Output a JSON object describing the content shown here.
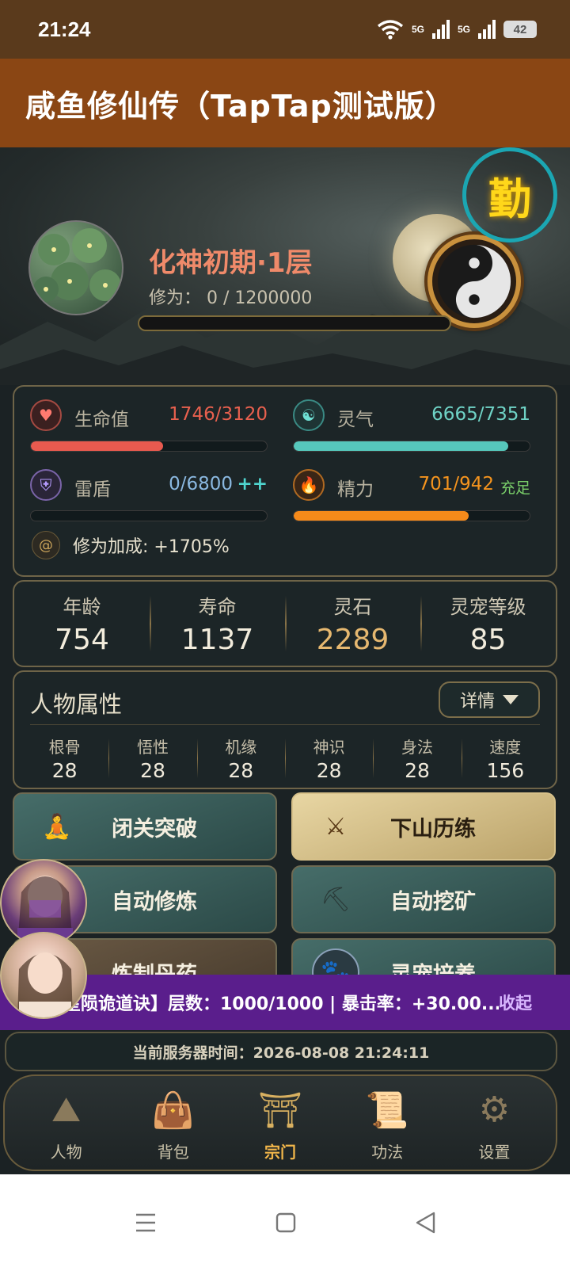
{
  "status_bar": {
    "time": "21:24",
    "network1": "5G",
    "network2": "5G",
    "battery": "42"
  },
  "app_bar": {
    "title": "咸鱼修仙传（TapTap测试版）"
  },
  "hero": {
    "badge": "勤",
    "realm": "化神初期·1层",
    "cultivation": "修为：  0 / 1200000",
    "cultivation_progress": 0
  },
  "stats": {
    "hp": {
      "label": "生命值",
      "value": "1746/3120",
      "fill": 0.56,
      "color": "#e85a4f"
    },
    "qi": {
      "label": "灵气",
      "value": "6665/7351",
      "fill": 0.91,
      "color": "#56c8bc"
    },
    "shield": {
      "label": "雷盾",
      "value": "0/6800",
      "suffix": "++",
      "fill": 0.0,
      "color": "#5aa8d8"
    },
    "energy": {
      "label": "精力",
      "value": "701/942",
      "suffix": "充足",
      "fill": 0.74,
      "color": "#f58a1a"
    },
    "bonus": "修为加成: +1705%"
  },
  "quick_stats": [
    {
      "label": "年龄",
      "value": "754"
    },
    {
      "label": "寿命",
      "value": "1137"
    },
    {
      "label": "灵石",
      "value": "2289"
    },
    {
      "label": "灵宠等级",
      "value": "85"
    }
  ],
  "attributes": {
    "title": "人物属性",
    "detail_label": "详情",
    "items": [
      {
        "label": "根骨",
        "value": "28"
      },
      {
        "label": "悟性",
        "value": "28"
      },
      {
        "label": "机缘",
        "value": "28"
      },
      {
        "label": "神识",
        "value": "28"
      },
      {
        "label": "身法",
        "value": "28"
      },
      {
        "label": "速度",
        "value": "156"
      }
    ]
  },
  "actions": {
    "seclusion": "闭关突破",
    "travel": "下山历练",
    "auto_cultivate": "自动修炼",
    "auto_mine": "自动挖矿",
    "alchemy": "炼制丹药",
    "pet": "灵宠培养"
  },
  "banner": {
    "text": "星陨诡道诀】层数：1000/1000 | 暴击率：+30.00...",
    "collapse": "收起"
  },
  "server_time": "当前服务器时间：2026-08-08 21:24:11",
  "nav": [
    {
      "label": "人物"
    },
    {
      "label": "背包"
    },
    {
      "label": "宗门"
    },
    {
      "label": "功法"
    },
    {
      "label": "设置"
    }
  ],
  "colors": {
    "accent": "#8a4614",
    "stone": "#e6b870",
    "banner": "#5a1e8c"
  }
}
